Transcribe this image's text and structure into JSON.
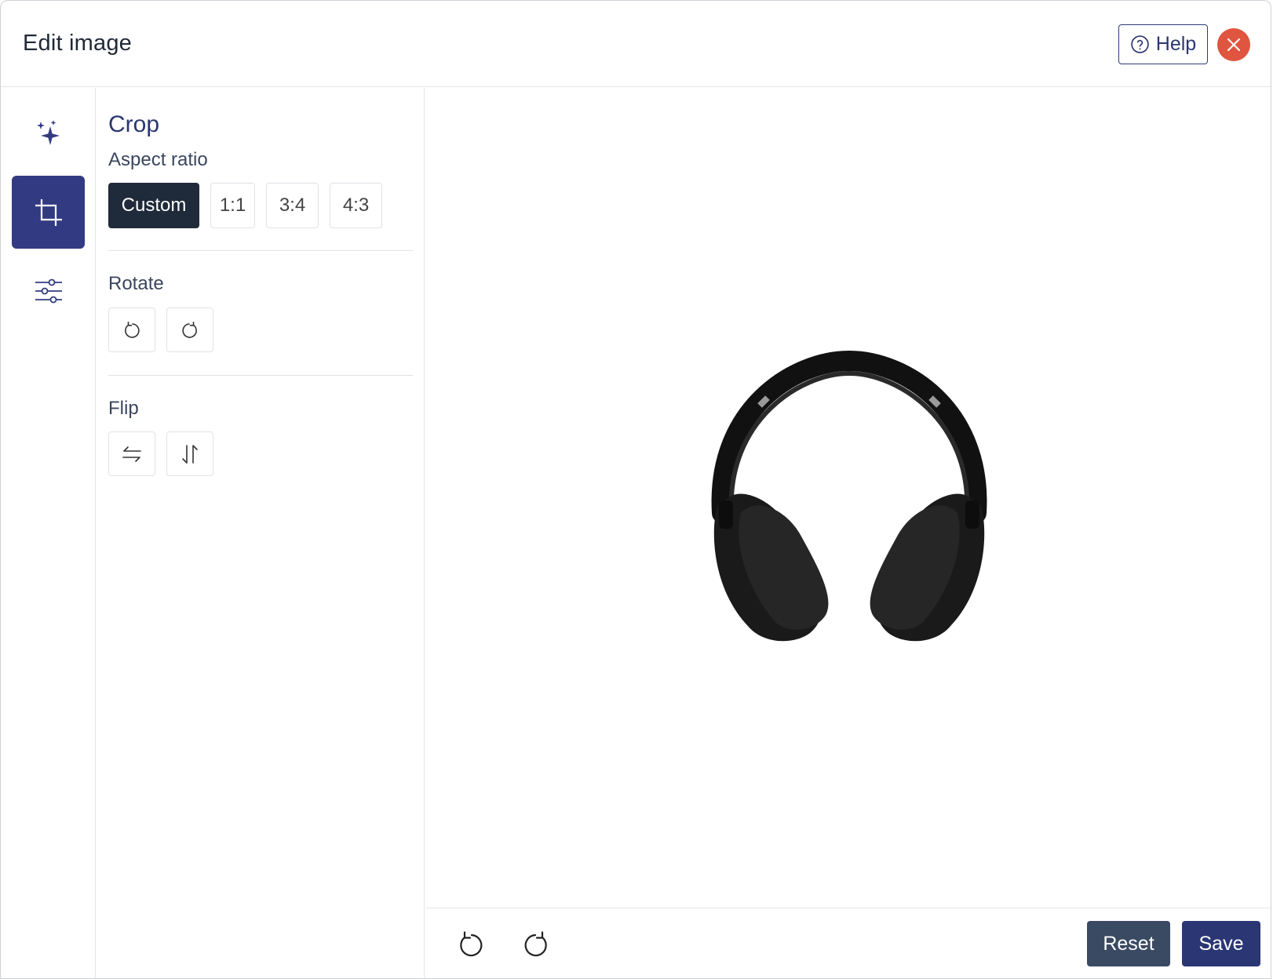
{
  "header": {
    "title": "Edit image",
    "help_label": "Help",
    "help_icon": "question-circle-icon",
    "close_icon": "close-icon"
  },
  "rail": {
    "items": [
      {
        "icon": "sparkles-icon",
        "active": false
      },
      {
        "icon": "crop-icon",
        "active": true
      },
      {
        "icon": "sliders-icon",
        "active": false
      }
    ]
  },
  "panel": {
    "title": "Crop",
    "aspect_ratio": {
      "label": "Aspect ratio",
      "options": [
        "Custom",
        "1:1",
        "3:4",
        "4:3"
      ],
      "selected": "Custom"
    },
    "rotate": {
      "label": "Rotate",
      "buttons": [
        "rotate-left-icon",
        "rotate-right-icon"
      ]
    },
    "flip": {
      "label": "Flip",
      "buttons": [
        "flip-horizontal-icon",
        "flip-vertical-icon"
      ]
    }
  },
  "canvas": {
    "image_subject": "headphones"
  },
  "footer": {
    "undo_icon": "undo-icon",
    "redo_icon": "redo-icon",
    "reset_label": "Reset",
    "save_label": "Save"
  },
  "colors": {
    "accent": "#323b82",
    "selected_option": "#1f2a3a",
    "close": "#e0553f",
    "reset": "#3a4a62",
    "save": "#2b3675"
  }
}
